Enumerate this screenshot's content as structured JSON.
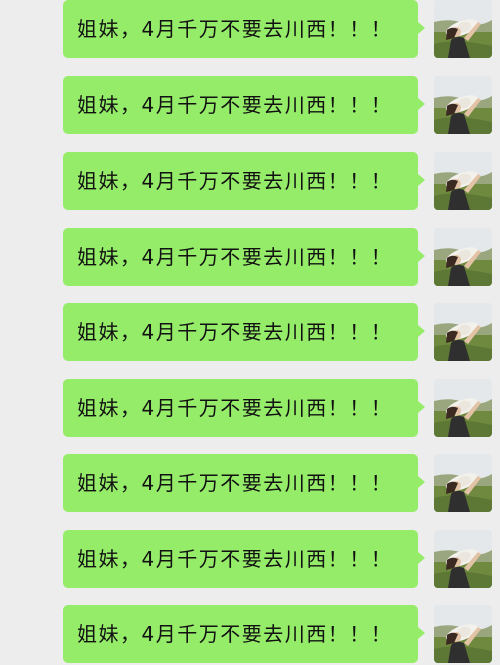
{
  "colors": {
    "background": "#ededed",
    "bubble": "#95ec69",
    "text": "#111111"
  },
  "messages": [
    {
      "text": "姐妹，4月千万不要去川西！！！",
      "sender": "self",
      "avatar_icon": "user-avatar-photo"
    },
    {
      "text": "姐妹，4月千万不要去川西！！！",
      "sender": "self",
      "avatar_icon": "user-avatar-photo"
    },
    {
      "text": "姐妹，4月千万不要去川西！！！",
      "sender": "self",
      "avatar_icon": "user-avatar-photo"
    },
    {
      "text": "姐妹，4月千万不要去川西！！！",
      "sender": "self",
      "avatar_icon": "user-avatar-photo"
    },
    {
      "text": "姐妹，4月千万不要去川西！！！",
      "sender": "self",
      "avatar_icon": "user-avatar-photo"
    },
    {
      "text": "姐妹，4月千万不要去川西！！！",
      "sender": "self",
      "avatar_icon": "user-avatar-photo"
    },
    {
      "text": "姐妹，4月千万不要去川西！！！",
      "sender": "self",
      "avatar_icon": "user-avatar-photo"
    },
    {
      "text": "姐妹，4月千万不要去川西！！！",
      "sender": "self",
      "avatar_icon": "user-avatar-photo"
    },
    {
      "text": "姐妹，4月千万不要去川西！！！",
      "sender": "self",
      "avatar_icon": "user-avatar-photo"
    }
  ]
}
